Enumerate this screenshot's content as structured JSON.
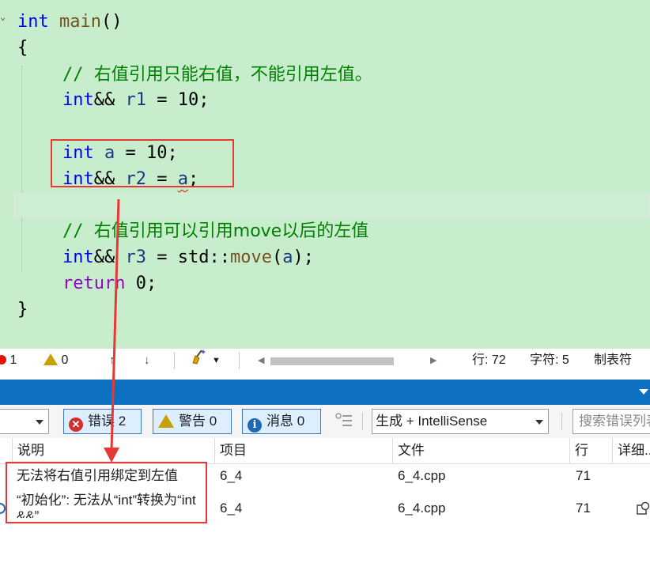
{
  "editor": {
    "lines": {
      "l1": {
        "kw": "int",
        "fn": "main",
        "rest": "()"
      },
      "l2": "{",
      "c1_slashes": "// ",
      "c1_text": "右值引用只能右值，不能引用左值。",
      "l4": {
        "kw": "int",
        "op": "&& ",
        "var": "r1",
        "rest": " = 10;"
      },
      "l6": {
        "kw": "int",
        "var": "a",
        "rest": " = 10;"
      },
      "l7": {
        "kw": "int",
        "op": "&& ",
        "var": "r2",
        "mid": " = ",
        "var2": "a",
        "end": ";"
      },
      "c2_slashes": "// ",
      "c2_text": "右值引用可以引用",
      "c2_move": "move",
      "c2_text2": "以后的左值",
      "l10": {
        "kw": "int",
        "op": "&& ",
        "var": "r3",
        "mid": " = std::",
        "fn": "move",
        "p1": "(",
        "var2": "a",
        "p2": ");"
      },
      "l11": {
        "kw": "return",
        "rest": " 0;"
      },
      "l12": "}"
    },
    "fold_glyph": "⌄"
  },
  "status_bar": {
    "error_count": "1",
    "warning_count": "0",
    "line_label": "行: 72",
    "char_label": "字符: 5",
    "tab_label": "制表符"
  },
  "error_list": {
    "toolbar": {
      "errors_label": "错误 2",
      "warnings_label": "警告 0",
      "messages_label": "消息 0",
      "source_combo": "生成 + IntelliSense",
      "search_placeholder": "搜索错误列表"
    },
    "columns": {
      "description": "说明",
      "project": "项目",
      "file": "文件",
      "line": "行",
      "details": "详细..."
    },
    "rows": [
      {
        "description": "无法将右值引用绑定到左值",
        "project": "6_4",
        "file": "6_4.cpp",
        "line": "71"
      },
      {
        "description": "“初始化”: 无法从“int”转换为“int",
        "description_wrap": "&&”",
        "project": "6_4",
        "file": "6_4.cpp",
        "line": "71"
      }
    ]
  },
  "colors": {
    "editor_bg": "#c7edcc",
    "keyword": "#0000ff",
    "comment": "#008000",
    "annotation_red": "#e53935",
    "panel_title": "#0e70c0"
  }
}
